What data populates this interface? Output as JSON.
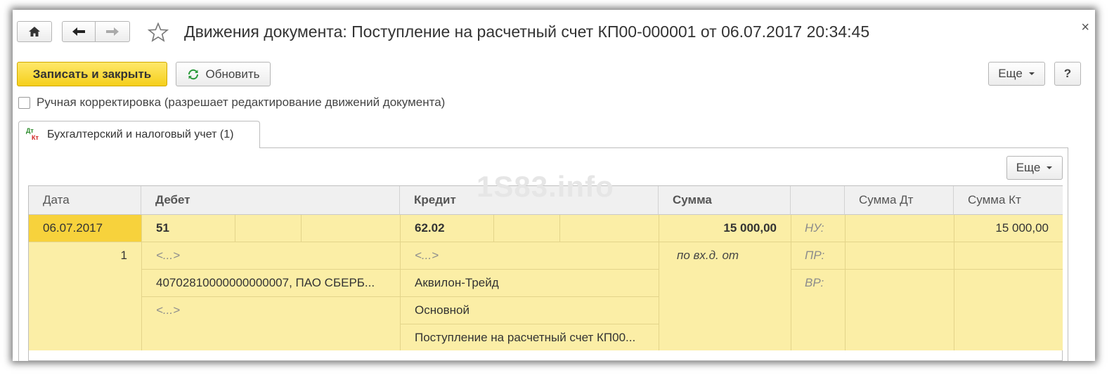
{
  "window": {
    "title": "Движения документа: Поступление на расчетный счет КП00-000001 от 06.07.2017 20:34:45",
    "close_symbol": "×"
  },
  "nav": {
    "home_icon": "home-icon",
    "back_icon": "arrow-left-icon",
    "forward_icon": "arrow-right-icon",
    "favorite_icon": "star-icon"
  },
  "toolbar": {
    "save_close_label": "Записать и закрыть",
    "refresh_label": "Обновить",
    "more_label": "Еще",
    "help_label": "?"
  },
  "manual_edit": {
    "label": "Ручная корректировка (разрешает редактирование движений документа)",
    "checked": false
  },
  "tab": {
    "label": "Бухгалтерский и налоговый учет (1)",
    "icon_top": "Дт",
    "icon_bottom": "Кт"
  },
  "table_toolbar": {
    "more_label": "Еще"
  },
  "watermark": "1S83.info",
  "table": {
    "headers": {
      "date": "Дата",
      "debit": "Дебет",
      "credit": "Кредит",
      "sum": "Сумма",
      "blank": "",
      "sum_dt": "Сумма Дт",
      "sum_kt": "Сумма Кт"
    },
    "row": {
      "date": "06.07.2017",
      "number": "1",
      "debit_account": "51",
      "debit_subconto1": "<...>",
      "debit_subconto2": "40702810000000000007, ПАО СБЕРБ...",
      "debit_subconto3": "<...>",
      "credit_account": "62.02",
      "credit_subconto1": "<...>",
      "credit_subconto2": "Аквилон-Трейд",
      "credit_subconto3": "Основной",
      "credit_subconto4": "Поступление на расчетный счет КП00...",
      "sum": "15 000,00",
      "content": "по вх.д.  от",
      "nu_label": "НУ:",
      "pr_label": "ПР:",
      "vr_label": "ВР:",
      "sum_dt": "",
      "sum_kt": "15 000,00"
    }
  },
  "colors": {
    "accent_yellow": "#f5cf1a",
    "row_yellow": "#fbeea6",
    "selected_cell": "#f7d23c"
  }
}
